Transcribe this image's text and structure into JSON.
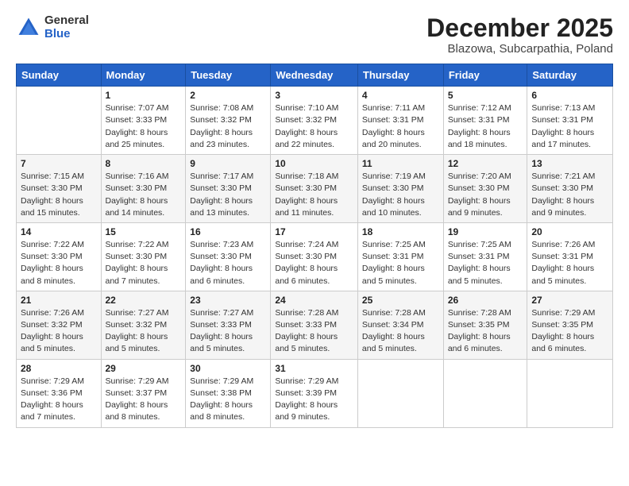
{
  "logo": {
    "general": "General",
    "blue": "Blue"
  },
  "title": "December 2025",
  "subtitle": "Blazowa, Subcarpathia, Poland",
  "header_days": [
    "Sunday",
    "Monday",
    "Tuesday",
    "Wednesday",
    "Thursday",
    "Friday",
    "Saturday"
  ],
  "weeks": [
    [
      {
        "day": "",
        "info": ""
      },
      {
        "day": "1",
        "info": "Sunrise: 7:07 AM\nSunset: 3:33 PM\nDaylight: 8 hours\nand 25 minutes."
      },
      {
        "day": "2",
        "info": "Sunrise: 7:08 AM\nSunset: 3:32 PM\nDaylight: 8 hours\nand 23 minutes."
      },
      {
        "day": "3",
        "info": "Sunrise: 7:10 AM\nSunset: 3:32 PM\nDaylight: 8 hours\nand 22 minutes."
      },
      {
        "day": "4",
        "info": "Sunrise: 7:11 AM\nSunset: 3:31 PM\nDaylight: 8 hours\nand 20 minutes."
      },
      {
        "day": "5",
        "info": "Sunrise: 7:12 AM\nSunset: 3:31 PM\nDaylight: 8 hours\nand 18 minutes."
      },
      {
        "day": "6",
        "info": "Sunrise: 7:13 AM\nSunset: 3:31 PM\nDaylight: 8 hours\nand 17 minutes."
      }
    ],
    [
      {
        "day": "7",
        "info": "Sunrise: 7:15 AM\nSunset: 3:30 PM\nDaylight: 8 hours\nand 15 minutes."
      },
      {
        "day": "8",
        "info": "Sunrise: 7:16 AM\nSunset: 3:30 PM\nDaylight: 8 hours\nand 14 minutes."
      },
      {
        "day": "9",
        "info": "Sunrise: 7:17 AM\nSunset: 3:30 PM\nDaylight: 8 hours\nand 13 minutes."
      },
      {
        "day": "10",
        "info": "Sunrise: 7:18 AM\nSunset: 3:30 PM\nDaylight: 8 hours\nand 11 minutes."
      },
      {
        "day": "11",
        "info": "Sunrise: 7:19 AM\nSunset: 3:30 PM\nDaylight: 8 hours\nand 10 minutes."
      },
      {
        "day": "12",
        "info": "Sunrise: 7:20 AM\nSunset: 3:30 PM\nDaylight: 8 hours\nand 9 minutes."
      },
      {
        "day": "13",
        "info": "Sunrise: 7:21 AM\nSunset: 3:30 PM\nDaylight: 8 hours\nand 9 minutes."
      }
    ],
    [
      {
        "day": "14",
        "info": "Sunrise: 7:22 AM\nSunset: 3:30 PM\nDaylight: 8 hours\nand 8 minutes."
      },
      {
        "day": "15",
        "info": "Sunrise: 7:22 AM\nSunset: 3:30 PM\nDaylight: 8 hours\nand 7 minutes."
      },
      {
        "day": "16",
        "info": "Sunrise: 7:23 AM\nSunset: 3:30 PM\nDaylight: 8 hours\nand 6 minutes."
      },
      {
        "day": "17",
        "info": "Sunrise: 7:24 AM\nSunset: 3:30 PM\nDaylight: 8 hours\nand 6 minutes."
      },
      {
        "day": "18",
        "info": "Sunrise: 7:25 AM\nSunset: 3:31 PM\nDaylight: 8 hours\nand 5 minutes."
      },
      {
        "day": "19",
        "info": "Sunrise: 7:25 AM\nSunset: 3:31 PM\nDaylight: 8 hours\nand 5 minutes."
      },
      {
        "day": "20",
        "info": "Sunrise: 7:26 AM\nSunset: 3:31 PM\nDaylight: 8 hours\nand 5 minutes."
      }
    ],
    [
      {
        "day": "21",
        "info": "Sunrise: 7:26 AM\nSunset: 3:32 PM\nDaylight: 8 hours\nand 5 minutes."
      },
      {
        "day": "22",
        "info": "Sunrise: 7:27 AM\nSunset: 3:32 PM\nDaylight: 8 hours\nand 5 minutes."
      },
      {
        "day": "23",
        "info": "Sunrise: 7:27 AM\nSunset: 3:33 PM\nDaylight: 8 hours\nand 5 minutes."
      },
      {
        "day": "24",
        "info": "Sunrise: 7:28 AM\nSunset: 3:33 PM\nDaylight: 8 hours\nand 5 minutes."
      },
      {
        "day": "25",
        "info": "Sunrise: 7:28 AM\nSunset: 3:34 PM\nDaylight: 8 hours\nand 5 minutes."
      },
      {
        "day": "26",
        "info": "Sunrise: 7:28 AM\nSunset: 3:35 PM\nDaylight: 8 hours\nand 6 minutes."
      },
      {
        "day": "27",
        "info": "Sunrise: 7:29 AM\nSunset: 3:35 PM\nDaylight: 8 hours\nand 6 minutes."
      }
    ],
    [
      {
        "day": "28",
        "info": "Sunrise: 7:29 AM\nSunset: 3:36 PM\nDaylight: 8 hours\nand 7 minutes."
      },
      {
        "day": "29",
        "info": "Sunrise: 7:29 AM\nSunset: 3:37 PM\nDaylight: 8 hours\nand 8 minutes."
      },
      {
        "day": "30",
        "info": "Sunrise: 7:29 AM\nSunset: 3:38 PM\nDaylight: 8 hours\nand 8 minutes."
      },
      {
        "day": "31",
        "info": "Sunrise: 7:29 AM\nSunset: 3:39 PM\nDaylight: 8 hours\nand 9 minutes."
      },
      {
        "day": "",
        "info": ""
      },
      {
        "day": "",
        "info": ""
      },
      {
        "day": "",
        "info": ""
      }
    ]
  ]
}
